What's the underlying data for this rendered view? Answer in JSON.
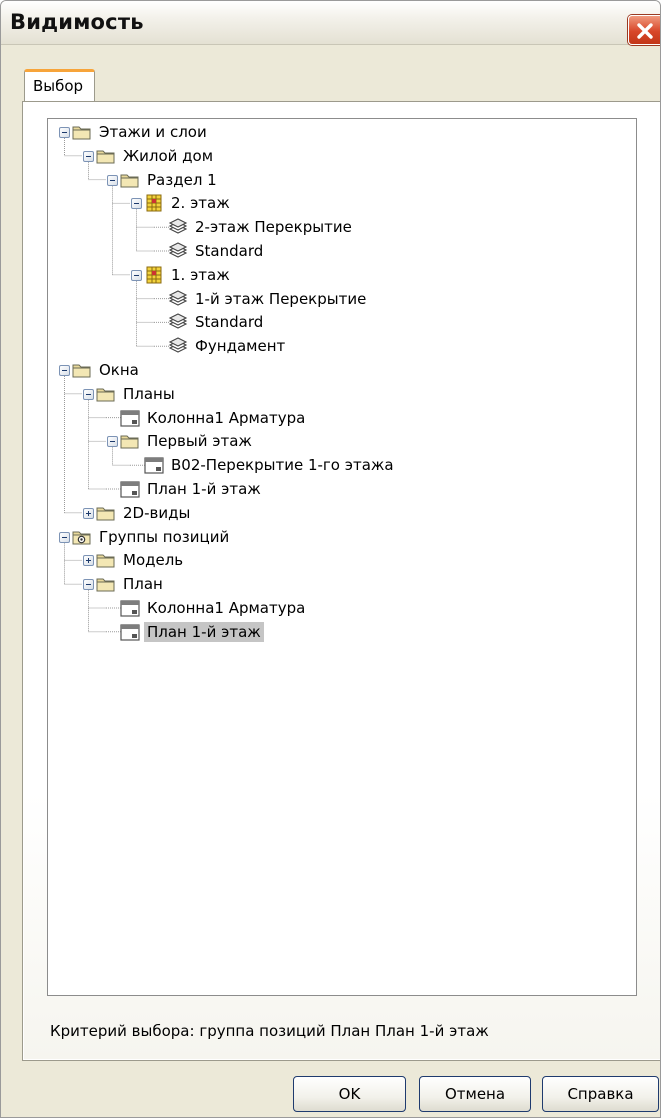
{
  "window": {
    "title": "Видимость",
    "tab": "Выбор"
  },
  "tree": [
    {
      "label": "Этажи и слои",
      "icon": "folder-icon",
      "level": 0,
      "toggle": "minus"
    },
    {
      "label": "Жилой дом",
      "icon": "folder-icon",
      "level": 1,
      "toggle": "minus"
    },
    {
      "label": "Раздел 1",
      "icon": "folder-icon",
      "level": 2,
      "toggle": "minus"
    },
    {
      "label": "2. этаж",
      "icon": "floor-icon",
      "level": 3,
      "toggle": "minus"
    },
    {
      "label": "2-этаж Перекрытие",
      "icon": "layer-icon",
      "level": 4,
      "toggle": ""
    },
    {
      "label": "Standard",
      "icon": "layer-icon",
      "level": 4,
      "toggle": ""
    },
    {
      "label": "1. этаж",
      "icon": "floor-icon",
      "level": 3,
      "toggle": "minus"
    },
    {
      "label": "1-й этаж Перекрытие",
      "icon": "layer-icon",
      "level": 4,
      "toggle": ""
    },
    {
      "label": "Standard",
      "icon": "layer-icon",
      "level": 4,
      "toggle": ""
    },
    {
      "label": "Фундамент",
      "icon": "layer-icon",
      "level": 4,
      "toggle": ""
    },
    {
      "label": "Окна",
      "icon": "folder-icon",
      "level": 0,
      "toggle": "minus"
    },
    {
      "label": "Планы",
      "icon": "folder-icon",
      "level": 1,
      "toggle": "minus"
    },
    {
      "label": "Колонна1 Арматура",
      "icon": "plan-icon",
      "level": 2,
      "toggle": ""
    },
    {
      "label": "Первый этаж",
      "icon": "folder-icon",
      "level": 2,
      "toggle": "minus"
    },
    {
      "label": "B02-Перекрытие 1-го этажа",
      "icon": "plan-icon",
      "level": 3,
      "toggle": ""
    },
    {
      "label": "План 1-й этаж",
      "icon": "plan-icon",
      "level": 2,
      "toggle": ""
    },
    {
      "label": "2D-виды",
      "icon": "folder-icon",
      "level": 1,
      "toggle": "plus"
    },
    {
      "label": "Группы позиций",
      "icon": "group-folder-icon",
      "level": 0,
      "toggle": "minus"
    },
    {
      "label": "Модель",
      "icon": "folder-icon",
      "level": 1,
      "toggle": "plus"
    },
    {
      "label": "План",
      "icon": "folder-icon",
      "level": 1,
      "toggle": "minus"
    },
    {
      "label": "Колонна1 Арматура",
      "icon": "plan-icon",
      "level": 2,
      "toggle": ""
    },
    {
      "label": "План 1-й этаж",
      "icon": "plan-icon",
      "level": 2,
      "toggle": "",
      "selected": true
    }
  ],
  "status_text": "Критерий выбора: группа позиций План План 1-й этаж",
  "buttons": {
    "ok": "OK",
    "cancel": "Отмена",
    "help": "Справка"
  },
  "colors": {
    "dialog_bg": "#ece9d8",
    "tab_accent": "#f7a43a",
    "close_button": "#d8472a",
    "selection": "#c5c5c5"
  }
}
